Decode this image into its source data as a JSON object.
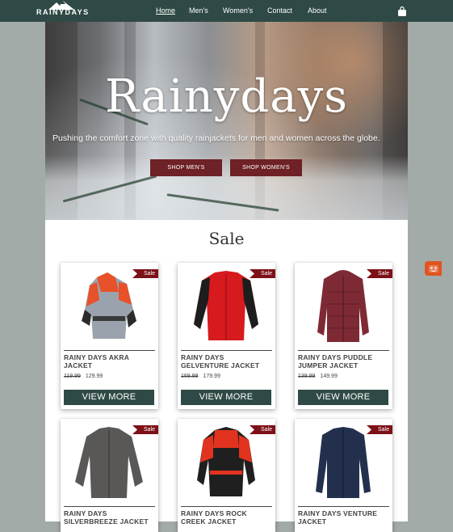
{
  "brand": {
    "logo_text": "RAINYDAYS"
  },
  "nav": {
    "items": [
      "Home",
      "Men's",
      "Women's",
      "Contact",
      "About"
    ],
    "active": "Home"
  },
  "hero": {
    "title": "Rainydays",
    "subtitle": "Pushing the comfort zone with quality rainjackets for men and women across the globe.",
    "buttons": [
      "SHOP MEN'S",
      "SHOP WOMEN'S"
    ]
  },
  "sale": {
    "title": "Sale",
    "ribbon": "Sale",
    "view_more": "VIEW MORE",
    "products": [
      {
        "name": "RAINY DAYS AKRA JACKET",
        "old_price": "119.99",
        "price": "129.99",
        "image": "orange-grey-sailing-jacket"
      },
      {
        "name": "RAINY DAYS GELVENTURE JACKET",
        "old_price": "169.99",
        "price": "179.99",
        "image": "red-black-softshell-jacket"
      },
      {
        "name": "RAINY DAYS PUDDLE JUMPER JACKET",
        "old_price": "139.99",
        "price": "149.99",
        "image": "burgundy-puffer-jacket"
      },
      {
        "name": "RAINY DAYS SILVERBREEZE JACKET",
        "old_price": "",
        "price": "",
        "image": "grey-bomber-jacket"
      },
      {
        "name": "RAINY DAYS ROCK CREEK JACKET",
        "old_price": "",
        "price": "",
        "image": "red-black-offshore-jacket"
      },
      {
        "name": "RAINY DAYS VENTURE JACKET",
        "old_price": "",
        "price": "",
        "image": "navy-fleece-jacket"
      }
    ]
  },
  "colors": {
    "header": "#2f4a46",
    "accent_button": "#6e2126",
    "sale_ribbon": "#7c1117",
    "chat_widget": "#e0541f"
  },
  "icons": {
    "cart": "shopping-bag-icon",
    "chat": "chat-widget-icon"
  }
}
